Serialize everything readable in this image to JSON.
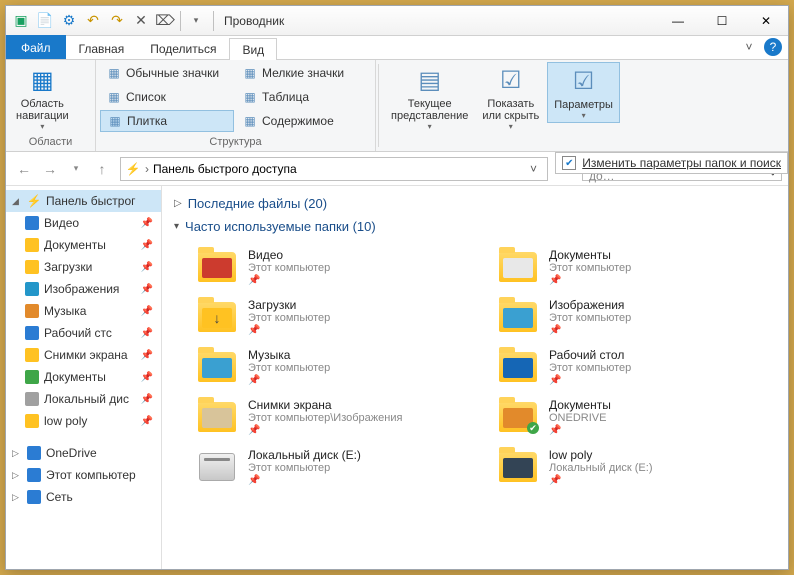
{
  "window": {
    "title": "Проводник",
    "controls": {
      "min": "—",
      "max": "☐",
      "close": "✕"
    }
  },
  "qat": [
    "new-tab",
    "new-doc",
    "properties",
    "undo",
    "redo",
    "cut",
    "delete",
    "qat-more"
  ],
  "tabs": {
    "file": "Файл",
    "items": [
      "Главная",
      "Поделиться",
      "Вид"
    ],
    "active": 2
  },
  "ribbon": {
    "group_areas": "Области",
    "group_layout": "Структура",
    "nav_pane": "Область\nнавигации",
    "layout_opts": [
      {
        "k": "large_icons",
        "label": "Обычные значки"
      },
      {
        "k": "small_icons",
        "label": "Мелкие значки"
      },
      {
        "k": "list",
        "label": "Список"
      },
      {
        "k": "table",
        "label": "Таблица"
      },
      {
        "k": "tiles",
        "label": "Плитка",
        "sel": true
      },
      {
        "k": "content",
        "label": "Содержимое"
      }
    ],
    "current_view": "Текущее\nпредставление",
    "show_hide": "Показать\nили скрыть",
    "options": "Параметры",
    "options_sub": "Изменить параметры папок и поиск"
  },
  "nav": {
    "address": "Панель быстрого доступа",
    "search_placeholder": "Поиск: Панель быстрого до…"
  },
  "sidebar": {
    "quick": "Панель быстрог",
    "pinned": [
      {
        "k": "video",
        "label": "Видео",
        "color": "#2b7cd3"
      },
      {
        "k": "docs",
        "label": "Документы",
        "color": "#ffc222"
      },
      {
        "k": "downloads",
        "label": "Загрузки",
        "color": "#ffc222"
      },
      {
        "k": "pictures",
        "label": "Изображения",
        "color": "#2396c9"
      },
      {
        "k": "music",
        "label": "Музыка",
        "color": "#e28a2b"
      },
      {
        "k": "desktop",
        "label": "Рабочий стс",
        "color": "#2b7cd3"
      },
      {
        "k": "screens",
        "label": "Снимки экрана",
        "color": "#ffc222"
      },
      {
        "k": "docs2",
        "label": "Документы",
        "color": "#3fa648"
      },
      {
        "k": "disk_e",
        "label": "Локальный дис",
        "color": "#a0a0a0"
      },
      {
        "k": "lowpoly",
        "label": "low poly",
        "color": "#ffc222"
      }
    ],
    "roots": [
      {
        "k": "onedrive",
        "label": "OneDrive",
        "color": "#2b7cd3"
      },
      {
        "k": "thispc",
        "label": "Этот компьютер",
        "color": "#2b7cd3"
      },
      {
        "k": "network",
        "label": "Сеть",
        "color": "#2b7cd3"
      }
    ]
  },
  "main": {
    "recent_label": "Последние файлы (20)",
    "freq_label": "Часто используемые папки (10)",
    "folders": [
      {
        "name": "Видео",
        "loc": "Этот компьютер",
        "inner": "#cc3b2e",
        "pin": true
      },
      {
        "name": "Документы",
        "loc": "Этот компьютер",
        "inner": "#e8e8e8",
        "pin": true
      },
      {
        "name": "Загрузки",
        "loc": "Этот компьютер",
        "inner": "#ffc222",
        "arrow": true,
        "pin": true
      },
      {
        "name": "Изображения",
        "loc": "Этот компьютер",
        "inner": "#3aa0d1",
        "pin": true
      },
      {
        "name": "Музыка",
        "loc": "Этот компьютер",
        "inner": "#3aa0d1",
        "pin": true
      },
      {
        "name": "Рабочий стол",
        "loc": "Этот компьютер",
        "inner": "#1566b5",
        "pin": true
      },
      {
        "name": "Снимки экрана",
        "loc": "Этот компьютер\\Изображения",
        "inner": "#d8c49a",
        "pin": true
      },
      {
        "name": "Документы",
        "loc": "ONEDRIVE",
        "inner": "#e28a2b",
        "badge": true,
        "pin": true
      },
      {
        "name": "Локальный диск (E:)",
        "loc": "Этот компьютер",
        "disk": true,
        "pin": true
      },
      {
        "name": "low poly",
        "loc": "Локальный диск (E:)",
        "inner": "#334455",
        "pin": true
      }
    ]
  }
}
